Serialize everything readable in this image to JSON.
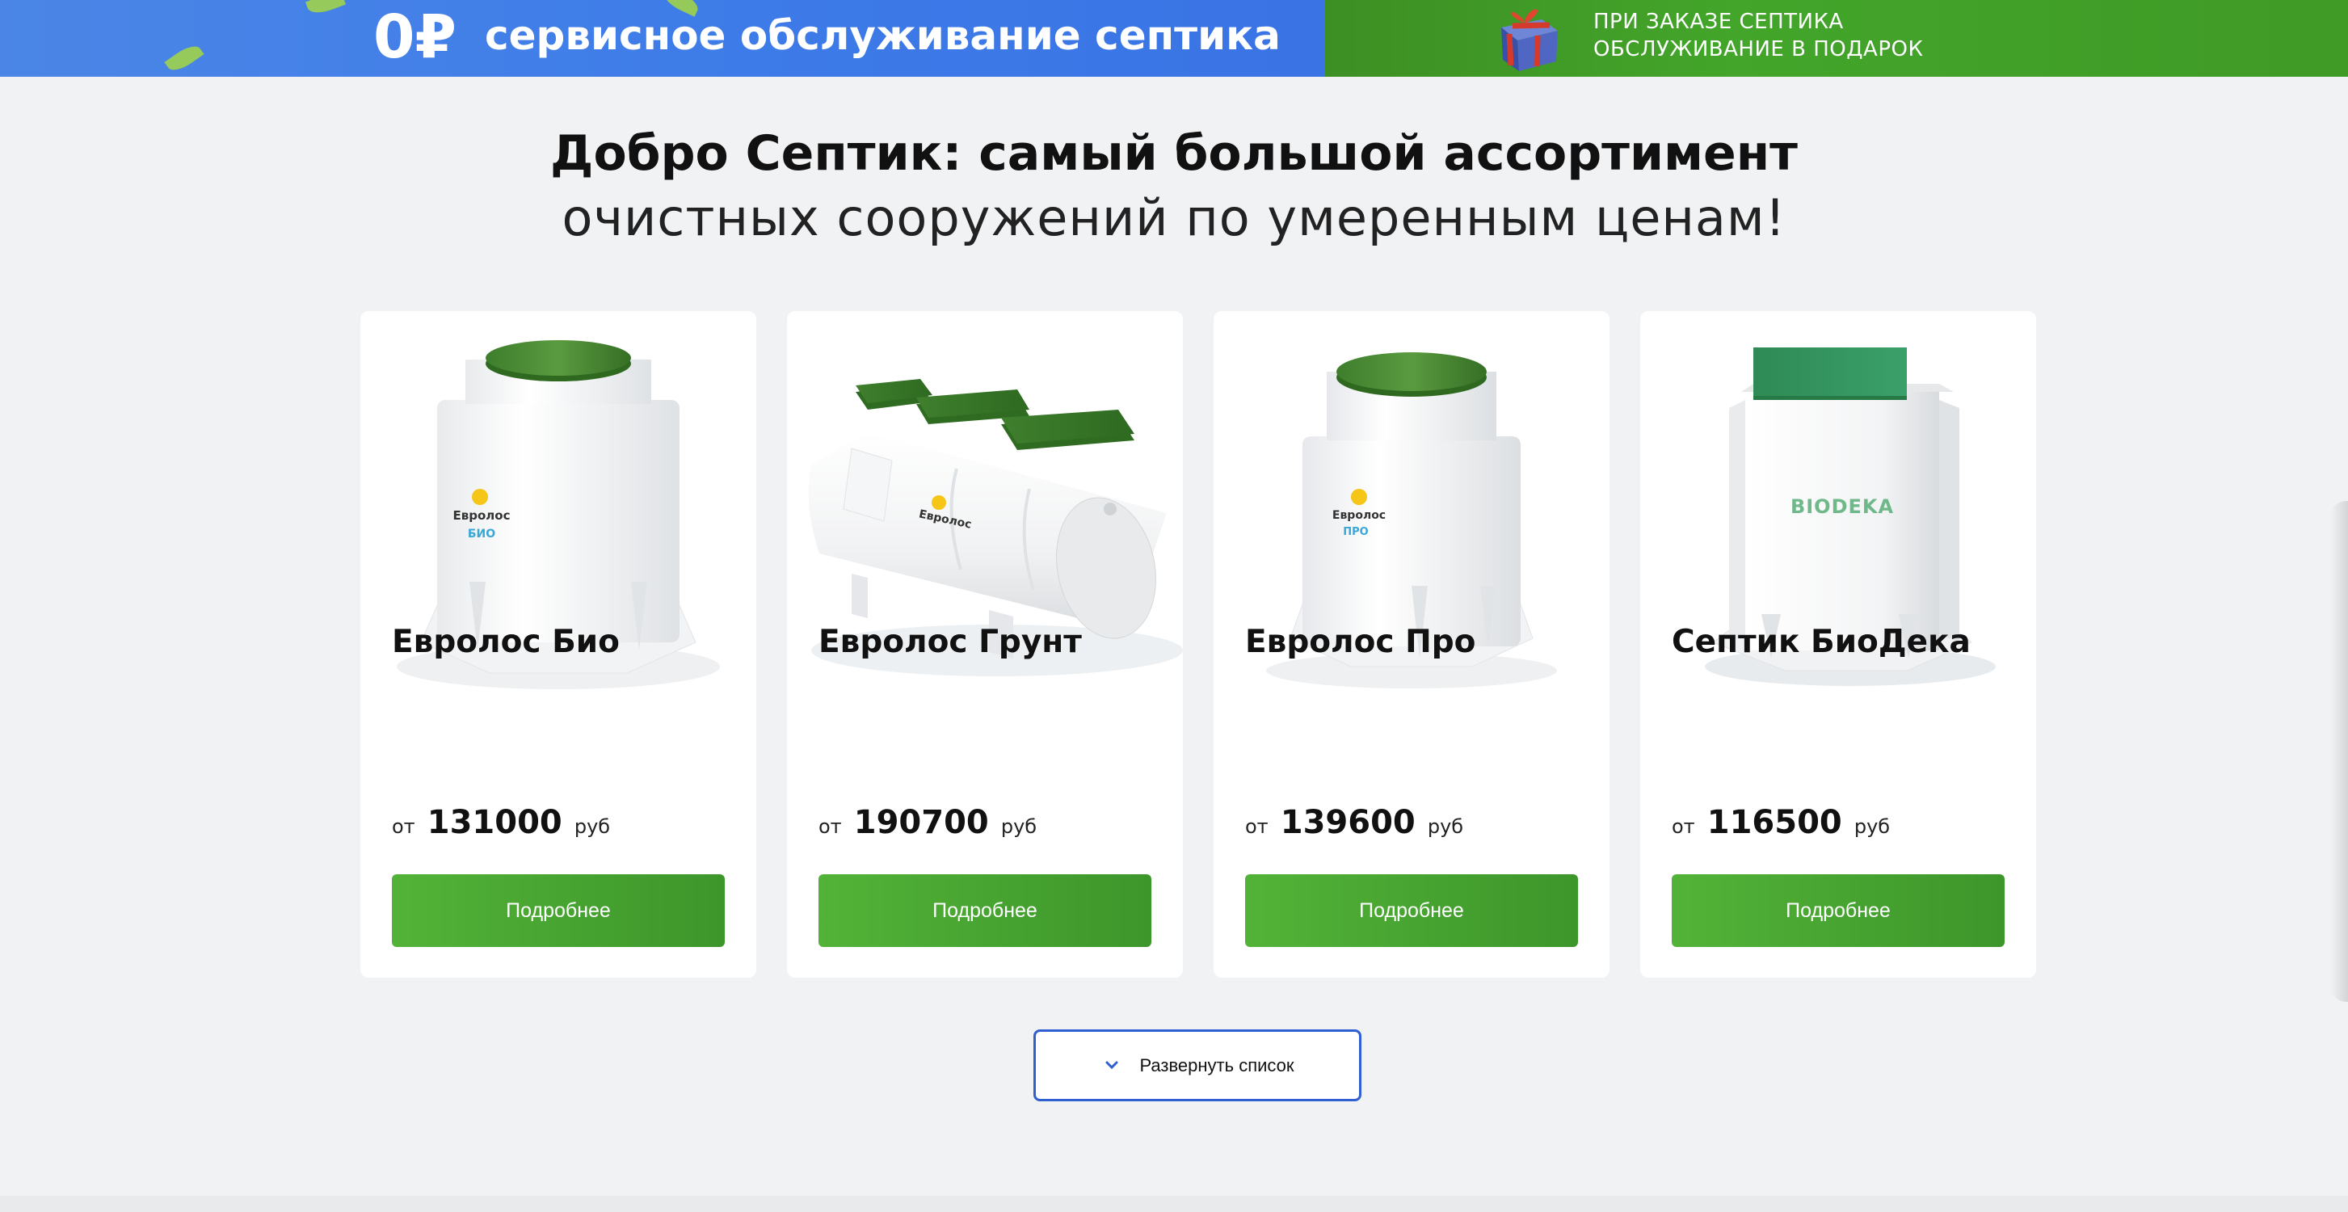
{
  "banner": {
    "zero_price": "0₽",
    "service_text": "сервисное обслуживание септика",
    "gift_line1": "ПРИ ЗАКАЗЕ СЕПТИКА",
    "gift_line2": "ОБСЛУЖИВАНИЕ В ПОДАРОК",
    "gift_icon": "gift-box-icon"
  },
  "heading": {
    "title": "Добро Септик: самый большой ассортимент",
    "subtitle": "очистных сооружений по умеренным ценам!"
  },
  "products": [
    {
      "name": "Евролос Био",
      "price_prefix": "от",
      "price": "131000",
      "currency": "руб",
      "button_label": "Подробнее",
      "image_brand": "Евролос",
      "image_label": "БИО"
    },
    {
      "name": "Евролос Грунт",
      "price_prefix": "от",
      "price": "190700",
      "currency": "руб",
      "button_label": "Подробнее",
      "image_brand": "Евролос"
    },
    {
      "name": "Евролос Про",
      "price_prefix": "от",
      "price": "139600",
      "currency": "руб",
      "button_label": "Подробнее",
      "image_brand": "Евролос",
      "image_label": "ПРО"
    },
    {
      "name": "Септик БиоДека",
      "price_prefix": "от",
      "price": "116500",
      "currency": "руб",
      "button_label": "Подробнее",
      "image_brand": "BIODEKA"
    }
  ],
  "expand": {
    "label": "Развернуть список",
    "icon": "chevron-down-icon"
  },
  "colors": {
    "banner_blue": "#3d7be8",
    "banner_green": "#43a52a",
    "button_green": "#4aa832",
    "expand_border": "#2f5fd0",
    "lid_green": "#3f8a2c"
  }
}
